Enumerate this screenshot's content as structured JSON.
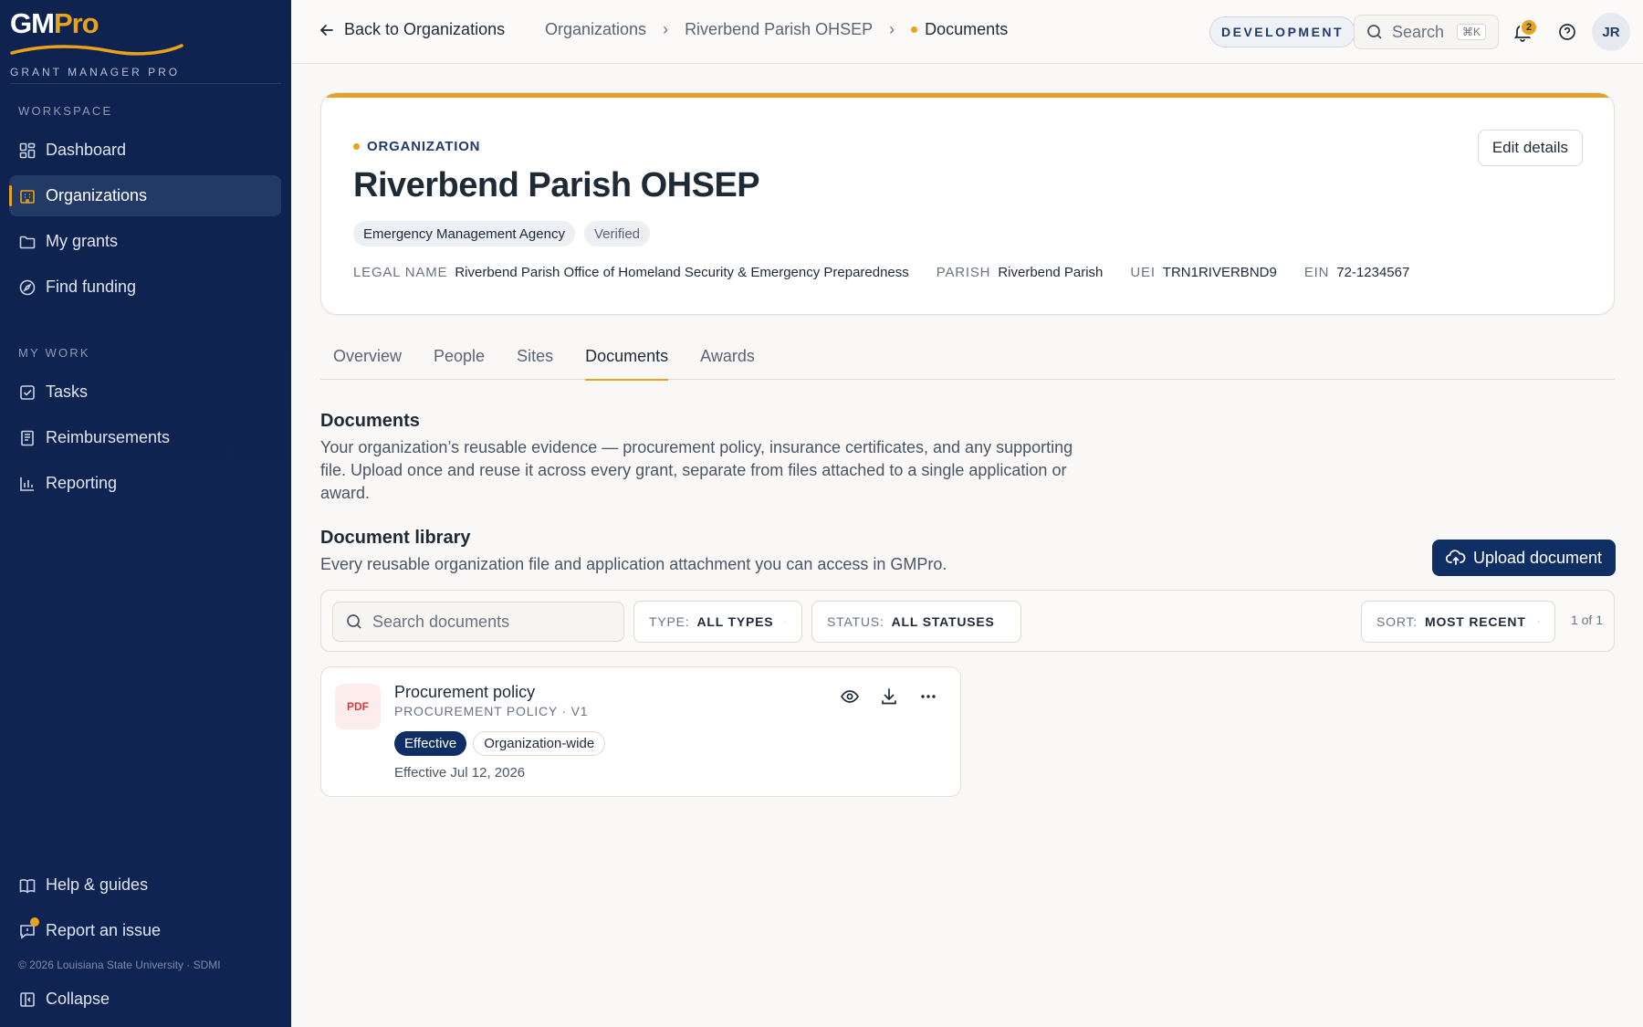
{
  "app": {
    "logo_gm": "GM",
    "logo_pro": "Pro",
    "logo_subtitle": "GRANT MANAGER PRO",
    "brand_colors": {
      "navy": "#0f2350",
      "gold": "#e9a21c"
    }
  },
  "sidebar": {
    "workspace_label": "WORKSPACE",
    "workspace_items": [
      {
        "label": "Dashboard",
        "icon": "dashboard-icon"
      },
      {
        "label": "Organizations",
        "icon": "building-icon",
        "active": true
      },
      {
        "label": "My grants",
        "icon": "folder-icon"
      },
      {
        "label": "Find funding",
        "icon": "compass-icon"
      }
    ],
    "mywork_label": "MY WORK",
    "mywork_items": [
      {
        "label": "Tasks",
        "icon": "checkbox-icon"
      },
      {
        "label": "Reimbursements",
        "icon": "receipt-icon"
      },
      {
        "label": "Reporting",
        "icon": "bar-chart-icon"
      }
    ],
    "help_label": "Help & guides",
    "report_label": "Report an issue",
    "copyright": "© 2026 Louisiana State University · SDMI",
    "collapse_label": "Collapse"
  },
  "topbar": {
    "back_label": "Back to Organizations",
    "breadcrumbs": [
      "Organizations",
      "Riverbend Parish OHSEP",
      "Documents"
    ],
    "environment": "DEVELOPMENT",
    "search_placeholder": "Search",
    "search_shortcut": "⌘K",
    "notification_count": "2",
    "avatar_initials": "JR"
  },
  "org": {
    "eyebrow": "ORGANIZATION",
    "name": "Riverbend Parish OHSEP",
    "tags": [
      "Emergency Management Agency",
      "Verified"
    ],
    "meta": {
      "legal_name_label": "LEGAL NAME",
      "legal_name": "Riverbend Parish Office of Homeland Security & Emergency Preparedness",
      "parish_label": "PARISH",
      "parish": "Riverbend Parish",
      "uei_label": "UEI",
      "uei": "TRN1RIVERBND9",
      "ein_label": "EIN",
      "ein": "72-1234567"
    },
    "edit_label": "Edit details"
  },
  "tabs": [
    "Overview",
    "People",
    "Sites",
    "Documents",
    "Awards"
  ],
  "active_tab": "Documents",
  "documents": {
    "title": "Documents",
    "description": "Your organization’s reusable evidence — procurement policy, insurance certificates, and any supporting file. Upload once and reuse it across every grant, separate from files attached to a single application or award.",
    "library_title": "Document library",
    "library_description": "Every reusable organization file and application attachment you can access in GMPro.",
    "upload_label": "Upload document",
    "filters": {
      "search_placeholder": "Search documents",
      "type_key": "TYPE:",
      "type_value": "ALL TYPES",
      "status_key": "STATUS:",
      "status_value": "ALL STATUSES",
      "sort_key": "SORT:",
      "sort_value": "MOST RECENT",
      "count": "1 of 1"
    },
    "items": [
      {
        "file_type": "PDF",
        "name": "Procurement policy",
        "subtitle": "PROCUREMENT POLICY · V1",
        "status": "Effective",
        "scope": "Organization-wide",
        "date": "Effective Jul 12, 2026"
      }
    ]
  }
}
